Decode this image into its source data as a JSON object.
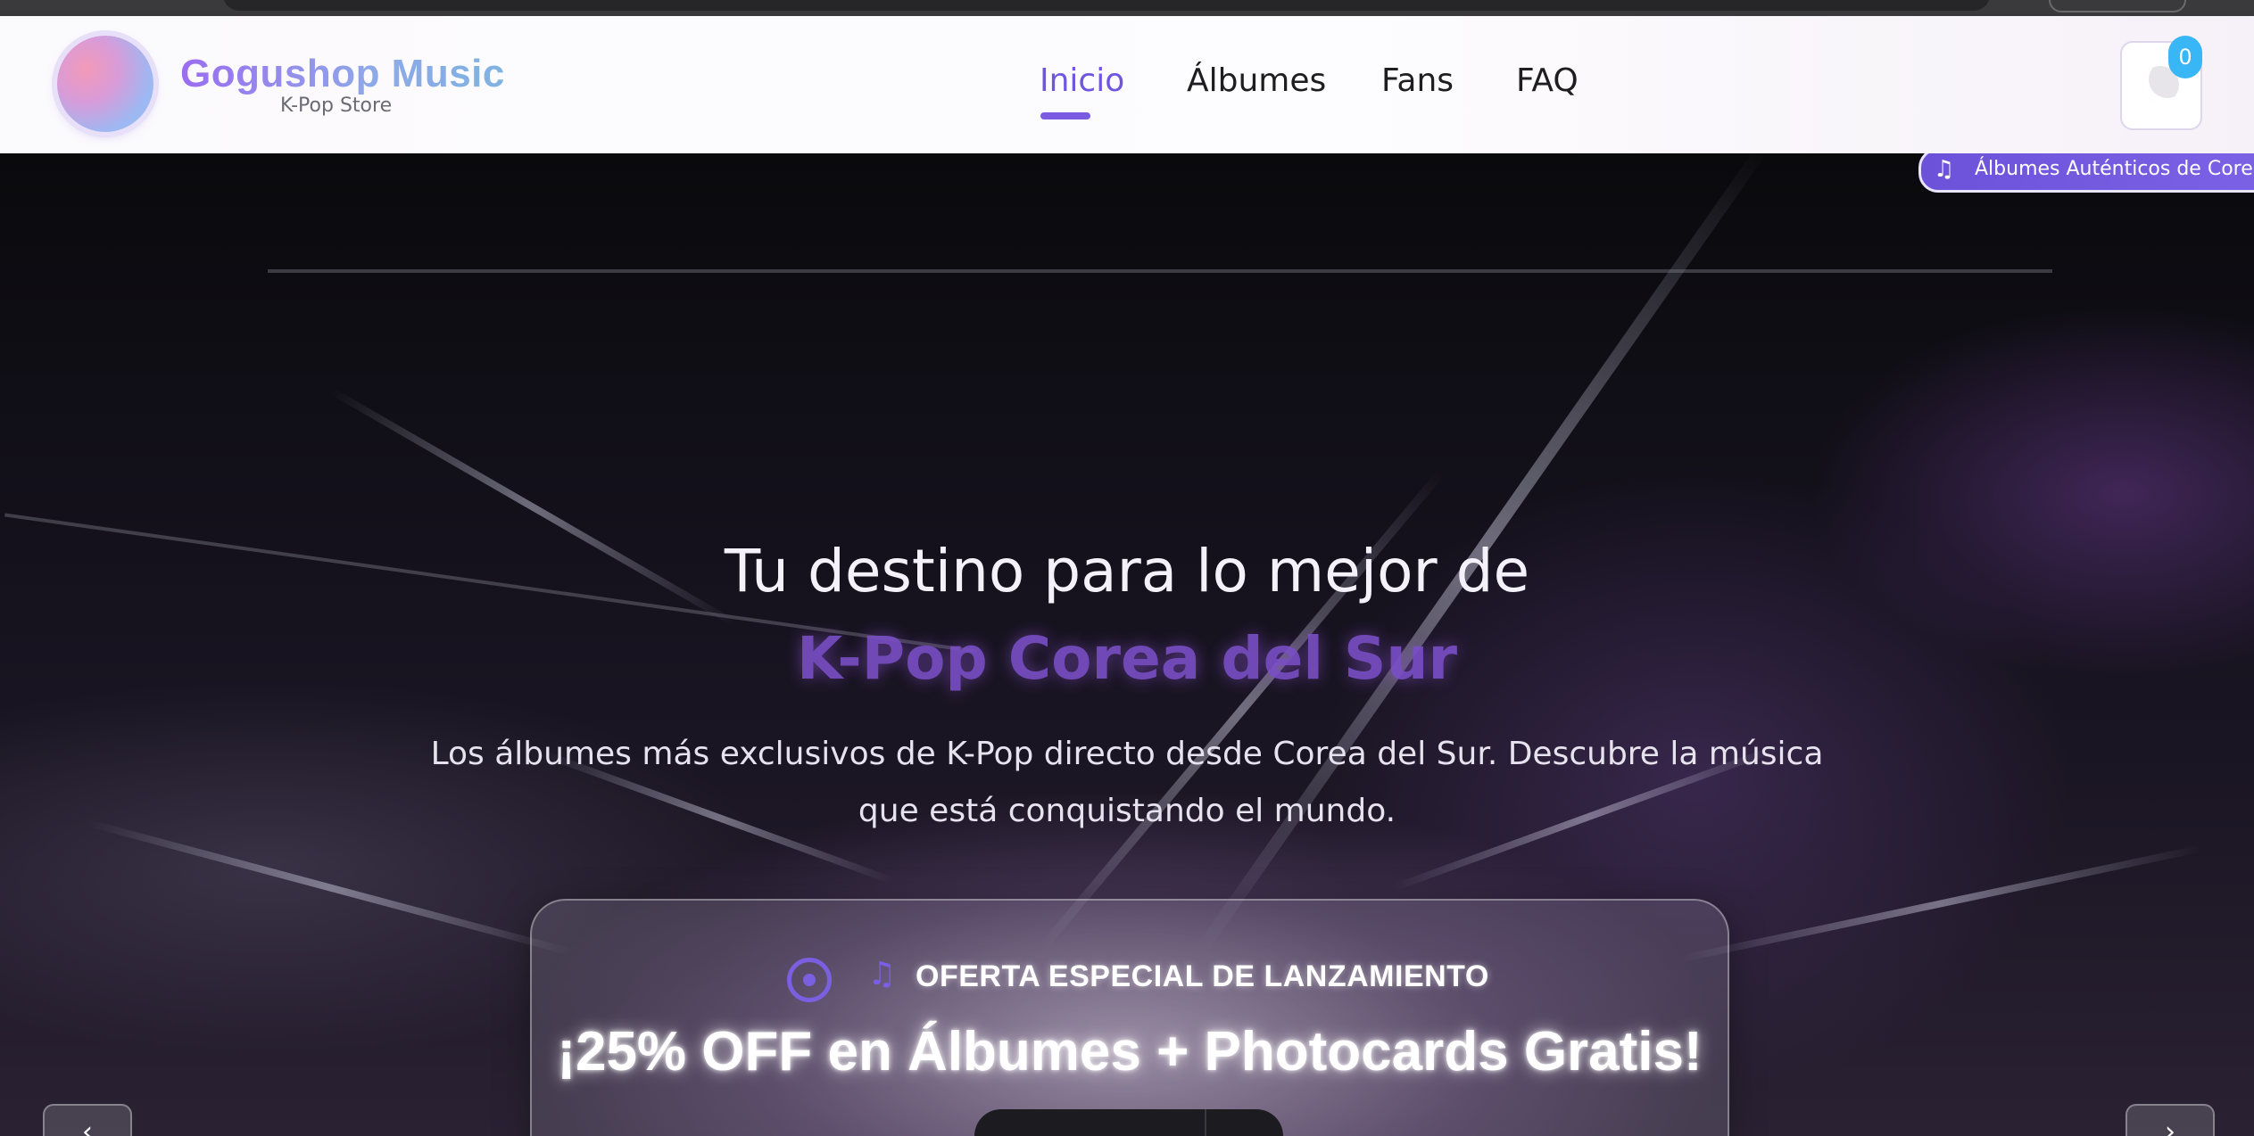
{
  "header": {
    "brand_name": "Gogushop Music",
    "brand_sub": "K-Pop Store",
    "nav": [
      "Inicio",
      "Álbumes",
      "Fans",
      "FAQ"
    ],
    "active_nav": "Inicio",
    "cart_count": "0"
  },
  "hero": {
    "top_badge": "Álbumes Auténticos de Corea",
    "top_badge_icon": "music-note-icon",
    "title": "Tu destino para lo mejor de",
    "highlight": "K-Pop Corea del Sur",
    "description": "Los álbumes más exclusivos de K-Pop directo desde Corea del Sur. Descubre la música que está conquistando el mundo.",
    "offer": {
      "label": "OFERTA ESPECIAL DE LANZAMIENTO",
      "label_icon": "music-note-icon",
      "headline": "¡25% OFF en Álbumes + Photocards Gratis!"
    }
  },
  "colors": {
    "accent": "#7a5ce3",
    "badge": "#38b6f5",
    "highlight": "#7b4fc8"
  }
}
